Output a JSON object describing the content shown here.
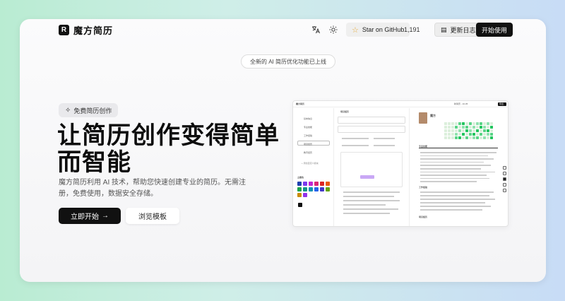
{
  "header": {
    "logo_mark": "R",
    "app_name": "魔方简历",
    "translate_icon": "translate-icon",
    "theme_icon": "sun-icon",
    "star_label": "Star on GitHub",
    "star_count": "1,191",
    "changelog_label": "更新日志",
    "start_label": "开始使用"
  },
  "announcement": "全新的 AI 简历优化功能已上线",
  "hero": {
    "badge": "免费简历创作",
    "title": "让简历创作变得简单而智能",
    "description": "魔方简历利用 AI 技术，帮助您快速创建专业的简历。无需注册，免费使用，数据安全存储。",
    "primary_cta": "立即开始",
    "primary_arrow": "→",
    "secondary_cta": "浏览模板"
  },
  "preview": {
    "app_title": "魔方简历",
    "resume_name": "魔方",
    "export_label": "导出",
    "title_field": "新简历 - 10-05",
    "sidebar_items": [
      "基本信息",
      "专业技能",
      "工作经验",
      "项目经历",
      "教育经历"
    ],
    "add_section": "+ 添加自定义模块",
    "theme_label": "主题色",
    "section_skills": "专业技能",
    "section_work": "工作经验",
    "section_project": "项目经历",
    "editor_title": "项目经历",
    "swatch_colors": [
      "#1e40af",
      "#7c3aed",
      "#c026d3",
      "#db2777",
      "#dc2626",
      "#ea580c",
      "#16a34a",
      "#0d9488",
      "#0891b2",
      "#2563eb",
      "#4338ca",
      "#65a30d",
      "#ca8a04",
      "#9333ea"
    ],
    "heat_color": "#22c55e"
  },
  "colors": {
    "primary": "#111111",
    "star": "#e5a93a"
  }
}
